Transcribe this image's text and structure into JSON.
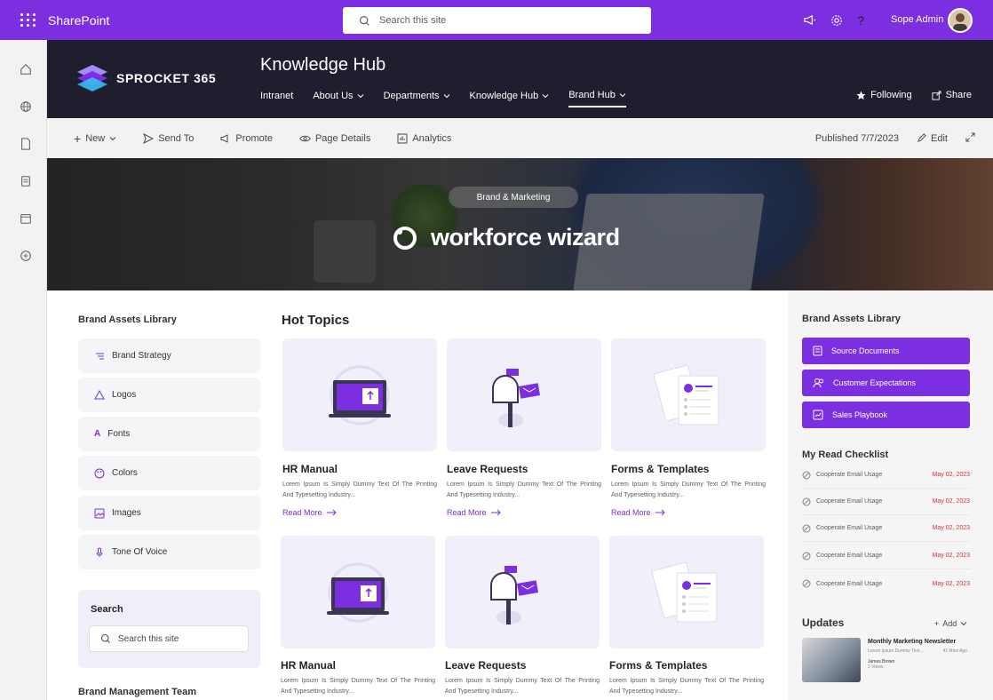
{
  "suite": {
    "app_name": "SharePoint",
    "search_placeholder": "Search this site",
    "user_name": "Sope Admin"
  },
  "header": {
    "logo_text": "SPROCKET 365",
    "site_title": "Knowledge Hub",
    "nav": [
      {
        "label": "Intranet",
        "dropdown": false
      },
      {
        "label": "About Us",
        "dropdown": true
      },
      {
        "label": "Departments",
        "dropdown": true
      },
      {
        "label": "Knowledge Hub",
        "dropdown": true
      },
      {
        "label": "Brand Hub",
        "dropdown": true,
        "active": true
      }
    ],
    "following_label": "Following",
    "share_label": "Share"
  },
  "commandbar": {
    "new_label": "New",
    "send_to_label": "Send To",
    "promote_label": "Promote",
    "page_details_label": "Page Details",
    "analytics_label": "Analytics",
    "published_label": "Published 7/7/2023",
    "edit_label": "Edit"
  },
  "hero": {
    "tag": "Brand & Marketing",
    "wordmark": "workforce wizard"
  },
  "left_library": {
    "title": "Brand Assets Library",
    "items": [
      {
        "label": "Brand Strategy",
        "icon": "list-icon"
      },
      {
        "label": "Logos",
        "icon": "shapes-icon"
      },
      {
        "label": "Fonts",
        "icon": "font-icon"
      },
      {
        "label": "Colors",
        "icon": "palette-icon"
      },
      {
        "label": "Images",
        "icon": "image-icon"
      },
      {
        "label": "Tone Of Voice",
        "icon": "microphone-icon"
      }
    ],
    "search_title": "Search",
    "search_placeholder": "Search this site",
    "team_title": "Brand Management Team"
  },
  "hot_topics": {
    "title": "Hot Topics",
    "cards": [
      {
        "title": "HR Manual",
        "text": "Lorem Ipsum Is Simply Dummy Text Of The Printing And Typesetting Industry...",
        "link": "Read More"
      },
      {
        "title": "Leave Requests",
        "text": "Lorem Ipsum Is Simply Dummy Text Of The Printing And Typesetting Industry...",
        "link": "Read More"
      },
      {
        "title": "Forms & Templates",
        "text": "Lorem Ipsum Is Simply Dummy Text Of The Printing And Typesetting Industry...",
        "link": "Read More"
      },
      {
        "title": "HR Manual",
        "text": "Lorem Ipsum Is Simply Dummy Text Of The Printing And Typesetting Industry..."
      },
      {
        "title": "Leave Requests",
        "text": "Lorem Ipsum Is Simply Dummy Text Of The Printing And Typesetting Industry..."
      },
      {
        "title": "Forms & Templates",
        "text": "Lorem Ipsum Is Simply Dummy Text Of The Printing And Typesetting Industry..."
      }
    ]
  },
  "right_pane": {
    "library_title": "Brand Assets Library",
    "buttons": [
      "Source Documents",
      "Customer Expectations",
      "Sales Playbook"
    ],
    "checklist_title": "My Read Checklist",
    "checklist": [
      {
        "name": "Cooperate Email Usage",
        "date": "May 02, 2023"
      },
      {
        "name": "Cooperate Email Usage",
        "date": "May 02, 2023"
      },
      {
        "name": "Cooperate Email Usage",
        "date": "May 02, 2023"
      },
      {
        "name": "Cooperate Email Usage",
        "date": "May 02, 2023"
      },
      {
        "name": "Cooperate Email Usage",
        "date": "May 02, 2023"
      }
    ],
    "updates_title": "Updates",
    "add_label": "Add",
    "news": {
      "title": "Monthly Marketing Newsletter",
      "desc": "Lorem Ipsum Dummy Text...",
      "time": "41 Mins Ago",
      "author": "James Brown",
      "views": "2 Views"
    }
  },
  "colors": {
    "accent": "#7b2fe0",
    "header_bg": "#1f1e2e",
    "date_red": "#d13438"
  }
}
